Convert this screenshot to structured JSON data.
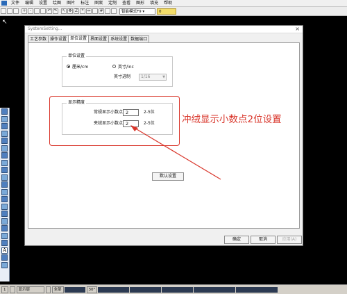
{
  "menubar": {
    "items": [
      "文件",
      "编辑",
      "设置",
      "绘图",
      "图片",
      "标注",
      "图案",
      "定制",
      "查看",
      "图形",
      "填充",
      "帮助"
    ]
  },
  "toolbar": {
    "icons": [
      "new-icon",
      "open-icon",
      "save-icon",
      "zoom-in-icon",
      "zoom-out-icon",
      "zoom-window-icon",
      "zoom-fit-icon",
      "undo-icon",
      "redo-icon",
      "cursor-icon",
      "move-icon",
      "text-icon",
      "star-icon",
      "flip-icon",
      "stitch-icon",
      "grid-icon",
      "color-icon",
      "thread-icon"
    ],
    "mode_select": "智能模式F9 ▾",
    "value_box": "0"
  },
  "dialog": {
    "title": "SystemSetting...",
    "tabs": [
      "工艺参数",
      "操作设置",
      "单位设置",
      "界面设置",
      "系统设置",
      "数据端口"
    ],
    "active_tab": "单位设置",
    "unit_group": {
      "label": "单位设置",
      "metric_label": "厘米/cm",
      "imperial_label": "英寸/inc",
      "inch_base_label": "英寸进制",
      "inch_base_value": "1/16"
    },
    "display_group": {
      "label": "显示精度",
      "normal_label": "常规显示小数点位:",
      "normal_value": "2",
      "normal_range": "2-5位",
      "quilt_label": "夹绒显示小数点位:",
      "quilt_value": "2",
      "quilt_range": "2-5位"
    },
    "default_button": "默认设置",
    "ok_button": "确定",
    "cancel_button": "取消",
    "apply_button": "应用(A)"
  },
  "annotation": {
    "text": "冲绒显示小数点2位设置",
    "color": "#d9362b"
  },
  "statusbar": {
    "page_left": "1",
    "scale": "显示层",
    "all_label": "全部",
    "angle": "30°"
  },
  "lefttool": {
    "text_tool": "A"
  }
}
